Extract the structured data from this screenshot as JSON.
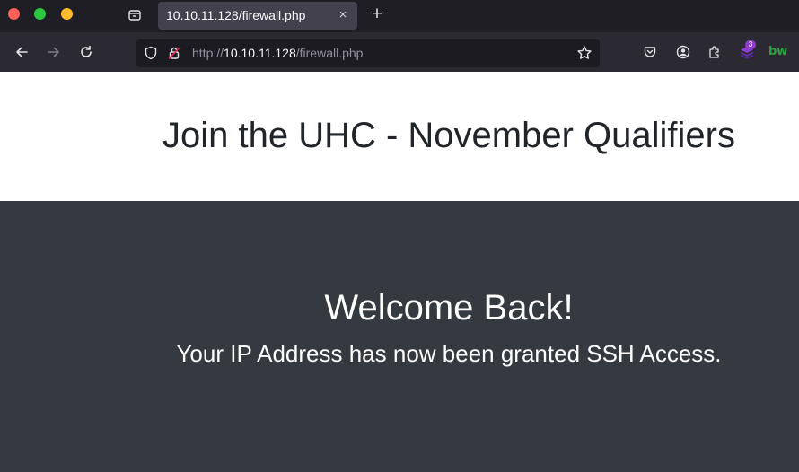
{
  "browser": {
    "tab": {
      "title": "10.10.11.128/firewall.php",
      "close_icon": "×"
    },
    "new_tab_icon": "+",
    "address_bar": {
      "scheme": "http://",
      "host": "10.10.11.128",
      "path": "/firewall.php"
    },
    "extension_badge": "3",
    "bitwarden_label": "bw"
  },
  "page": {
    "heading": "Join the UHC - November Qualifiers",
    "welcome": "Welcome Back!",
    "message": "Your IP Address has now been granted SSH Access."
  },
  "colors": {
    "titlebar": "#1f1e25",
    "navbar": "#2b2a33",
    "header_bg": "#ffffff",
    "main_bg": "#343a40"
  }
}
